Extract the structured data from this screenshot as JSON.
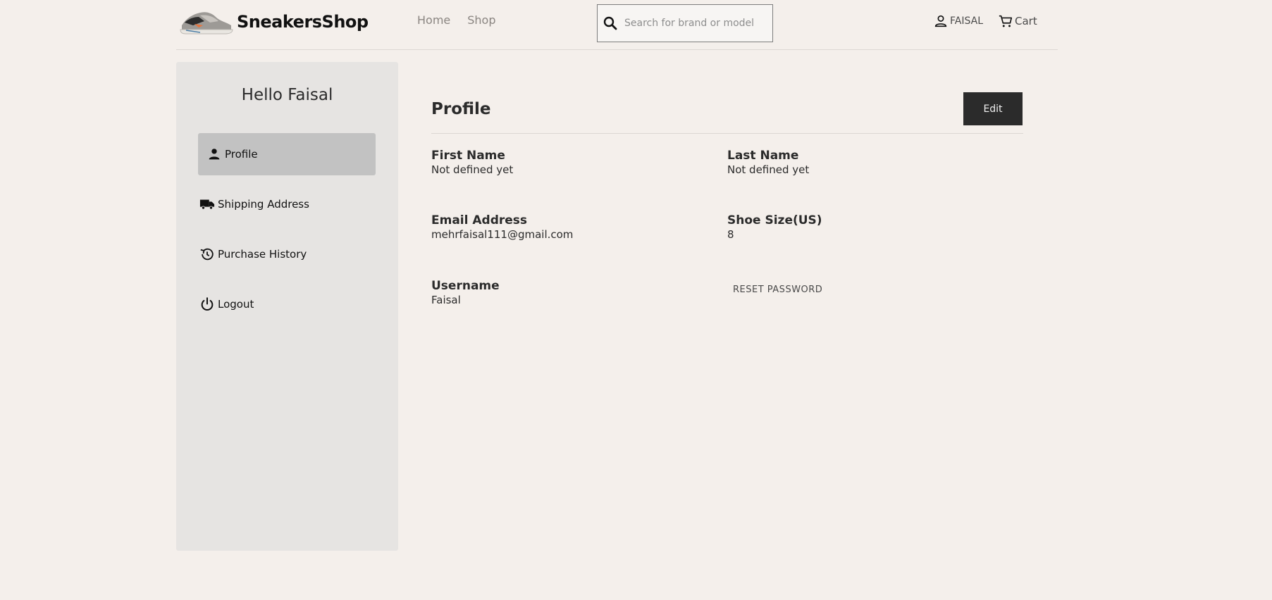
{
  "header": {
    "brand_name": "SneakersShop",
    "nav": [
      {
        "label": "Home"
      },
      {
        "label": "Shop"
      }
    ],
    "search": {
      "placeholder": "Search for brand or model",
      "value": ""
    },
    "user_label": "FAISAL",
    "cart_label": "Cart"
  },
  "sidebar": {
    "greeting": "Hello Faisal",
    "items": [
      {
        "label": "Profile",
        "icon": "person-icon",
        "active": true
      },
      {
        "label": "Shipping Address",
        "icon": "truck-icon"
      },
      {
        "label": "Purchase History",
        "icon": "history-icon"
      },
      {
        "label": "Logout",
        "icon": "power-icon"
      }
    ]
  },
  "main": {
    "title": "Profile",
    "edit_label": "Edit",
    "fields": {
      "first_name": {
        "label": "First Name",
        "value": "Not defined yet"
      },
      "last_name": {
        "label": "Last Name",
        "value": "Not defined yet"
      },
      "email": {
        "label": "Email Address",
        "value": "mehrfaisal111@gmail.com"
      },
      "shoe_size": {
        "label": "Shoe Size(US)",
        "value": "8"
      },
      "username": {
        "label": "Username",
        "value": "Faisal"
      }
    },
    "reset_password_label": "RESET PASSWORD"
  },
  "colors": {
    "background": "#f4efeb",
    "sidebar_bg": "#e6e4e2",
    "active_item_bg": "#c2c2c2",
    "button_dark": "#2b2b2b"
  }
}
